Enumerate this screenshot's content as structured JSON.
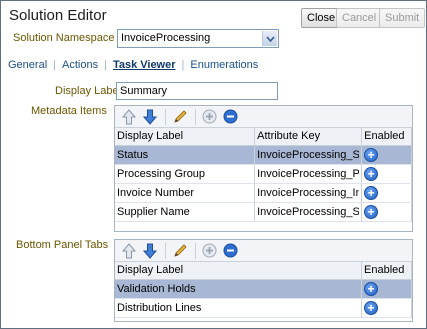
{
  "header": {
    "title": "Solution Editor",
    "buttons": {
      "close": "Close",
      "cancel": "Cancel",
      "submit": "Submit"
    }
  },
  "namespace": {
    "label": "Solution Namespace",
    "value": "InvoiceProcessing"
  },
  "tabs": [
    {
      "label": "General"
    },
    {
      "label": "Actions"
    },
    {
      "label": "Task Viewer",
      "active": true
    },
    {
      "label": "Enumerations"
    }
  ],
  "display_label": {
    "label": "Display Label",
    "value": "Summary"
  },
  "metadata": {
    "label": "Metadata Items",
    "columns": [
      "Display Label",
      "Attribute Key",
      "Enabled"
    ],
    "rows": [
      {
        "display": "Status",
        "key": "InvoiceProcessing_St",
        "selected": true
      },
      {
        "display": "Processing Group",
        "key": "InvoiceProcessing_Pr"
      },
      {
        "display": "Invoice Number",
        "key": "InvoiceProcessing_In"
      },
      {
        "display": "Supplier Name",
        "key": "InvoiceProcessing_Su"
      }
    ]
  },
  "bottom_tabs": {
    "label": "Bottom Panel Tabs",
    "columns": [
      "Display Label",
      "Enabled"
    ],
    "rows": [
      {
        "display": "Validation Holds",
        "selected": true
      },
      {
        "display": "Distribution Lines"
      }
    ]
  },
  "icons": {
    "move_up": "arrow-up-icon",
    "move_down": "arrow-down-icon",
    "edit": "pencil-icon",
    "add": "add-icon",
    "remove": "remove-icon",
    "enabled": "plus-circle-icon"
  },
  "colors": {
    "label_gold": "#6b5700",
    "link_blue": "#1b4f8a",
    "selected_row": "#a8b8d4",
    "border": "#a9b4c1"
  }
}
